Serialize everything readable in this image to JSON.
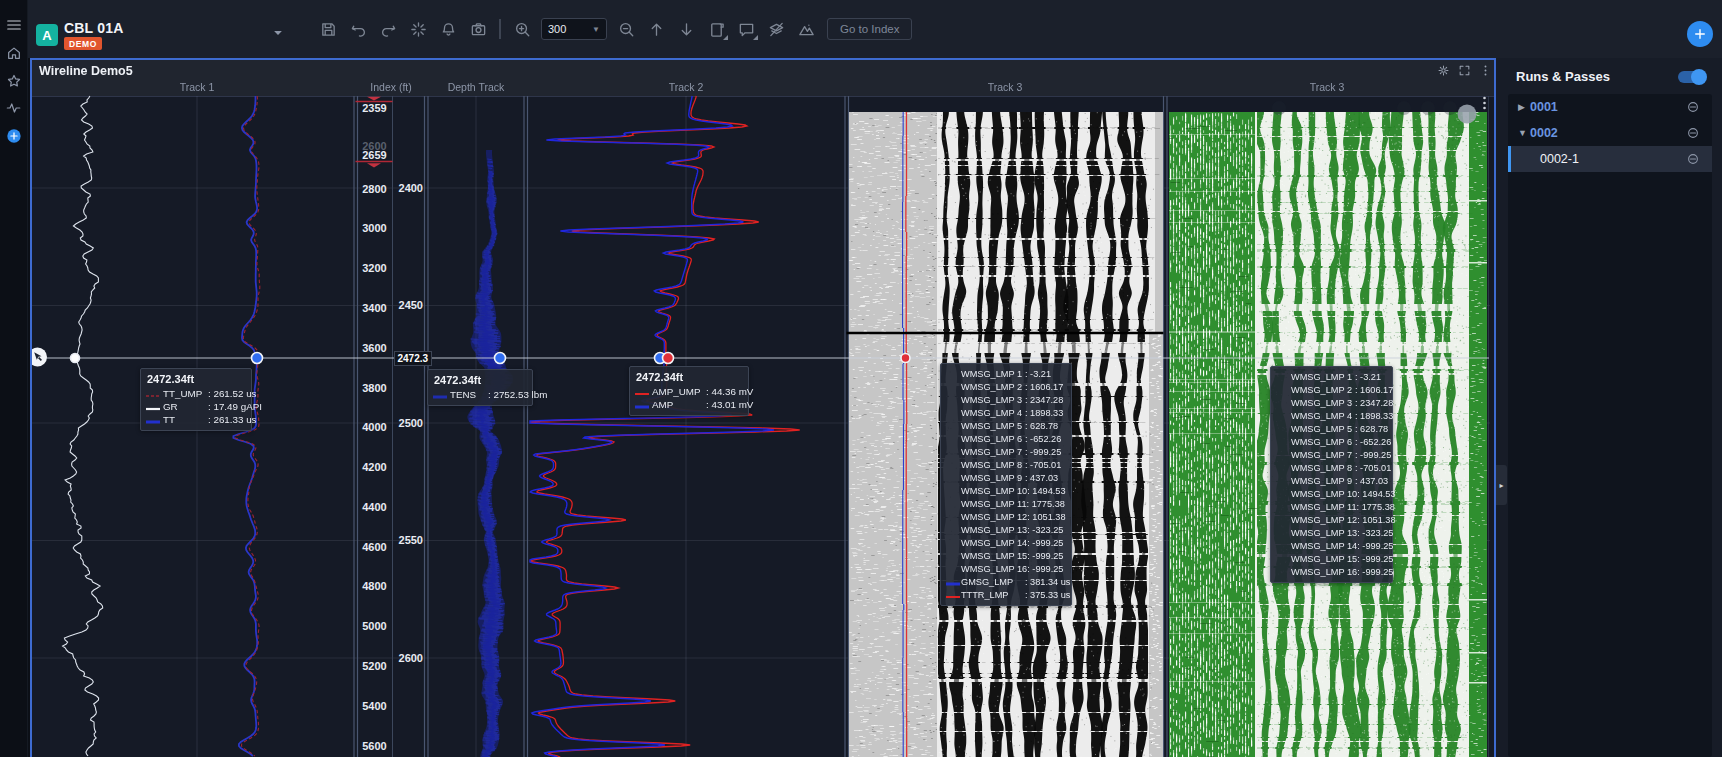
{
  "app": {
    "logo_glyph": "A",
    "title": "CBL 01A",
    "badge": "DEMO"
  },
  "sidebar": {
    "items": [
      {
        "icon": "menu-icon"
      },
      {
        "icon": "home-icon"
      },
      {
        "icon": "star-icon"
      },
      {
        "icon": "activity-icon"
      },
      {
        "icon": "plus-circle-icon"
      }
    ]
  },
  "toolbar": {
    "buttons_left": [
      "save",
      "undo",
      "redo",
      "auto-fit",
      "bell",
      "camera"
    ],
    "zoom_value": "300",
    "buttons_right": [
      "zoom-out",
      "arrow-up",
      "arrow-down",
      "report",
      "comment",
      "layers-off",
      "terrain"
    ],
    "buttons_with_submenu": [
      "report",
      "comment"
    ],
    "goto_label": "Go to Index",
    "add_label": "+"
  },
  "plot": {
    "title": "Wireline Demo5",
    "tracks": [
      {
        "label": "Track 1",
        "center": 197
      },
      {
        "label": "Index (ft)",
        "center": 391
      },
      {
        "label": "Depth Track",
        "center": 476
      },
      {
        "label": "Track 2",
        "center": 686
      },
      {
        "label": "Track 3",
        "center": 1005
      },
      {
        "label": "Track 3",
        "center": 1327
      }
    ],
    "curves": {
      "GR": {
        "color": "#dde3ec",
        "track": "Track 1"
      },
      "TT": {
        "color": "#2a36c8",
        "track": "Track 1"
      },
      "TT_UMP": {
        "color": "#9b2433",
        "track": "Track 1"
      },
      "TENS": {
        "color": "#2633cc",
        "track": "Depth Track"
      },
      "AMP": {
        "color": "#2026dd",
        "track": "Track 2"
      },
      "AMP_UMP": {
        "color": "#e02222",
        "track": "Track 2"
      },
      "VDL": {
        "color": "#0a0a0a",
        "track": "Track 3"
      },
      "VDL2": {
        "color": "#2b8a2b",
        "track": "Track 3"
      }
    }
  },
  "index_scale": {
    "overview_marker_top": "2359",
    "overview_faded_label": "2600",
    "overview_marker_bottom": "2659",
    "overview_ticks": [
      "2800",
      "3000",
      "3200",
      "3400",
      "3600",
      "3800",
      "4000",
      "4200",
      "4400",
      "4600",
      "4800",
      "5000",
      "5200",
      "5400",
      "5600"
    ],
    "inview_ticks": [
      "2400",
      "2450",
      "2500",
      "2550",
      "2600"
    ],
    "cursor_depth": "2472.3"
  },
  "tooltips": {
    "depth_header": "2472.34ft",
    "track1": {
      "rows": [
        {
          "name": "TT_UMP",
          "value": ": 261.52 us",
          "swatch": "red-dashed"
        },
        {
          "name": "GR",
          "value": ": 17.49 gAPI",
          "swatch": "white-solid"
        },
        {
          "name": "TT",
          "value": ": 261.33 us",
          "swatch": "blue-solid"
        }
      ]
    },
    "depth_track": {
      "rows": [
        {
          "name": "TENS",
          "value": ": 2752.53 lbm",
          "swatch": "navy-solid"
        }
      ]
    },
    "track2": {
      "rows": [
        {
          "name": "AMP_UMP",
          "value": ": 44.36 mV",
          "swatch": "red-solid"
        },
        {
          "name": "AMP",
          "value": ": 43.01 mV",
          "swatch": "blue-solid"
        }
      ]
    },
    "wmsg_labels": [
      "WMSG_LMP 1",
      "WMSG_LMP 2",
      "WMSG_LMP 3",
      "WMSG_LMP 4",
      "WMSG_LMP 5",
      "WMSG_LMP 6",
      "WMSG_LMP 7",
      "WMSG_LMP 8",
      "WMSG_LMP 9",
      "WMSG_LMP 10",
      "WMSG_LMP 11",
      "WMSG_LMP 12",
      "WMSG_LMP 13",
      "WMSG_LMP 14",
      "WMSG_LMP 15",
      "WMSG_LMP 16"
    ],
    "wmsg_values": [
      ": -3.21",
      ": 1606.17",
      ": 2347.28",
      ": 1898.33",
      ": 628.78",
      ": -652.26",
      ": -999.25",
      ": -705.01",
      ": 437.03",
      ": 1494.53",
      ": 1775.38",
      ": 1051.38",
      ": -323.25",
      ": -999.25",
      ": -999.25",
      ": -999.25"
    ],
    "wmsg_extra": [
      {
        "name": "GMSG_LMP",
        "value": ": 381.34 us",
        "swatch": "blue-solid"
      },
      {
        "name": "TTTR_LMP",
        "value": ": 375.33 us",
        "swatch": "red-solid"
      }
    ]
  },
  "right_panel": {
    "title": "Runs & Passes",
    "toggle_on": true,
    "items": [
      {
        "label": "0001",
        "caret": "right",
        "child": false,
        "selected": false
      },
      {
        "label": "0002",
        "caret": "down",
        "child": false,
        "selected": false
      },
      {
        "label": "0002-1",
        "caret": "none",
        "child": true,
        "selected": true
      }
    ]
  },
  "colors": {
    "accent_blue": "#2e8cf0",
    "badge_orange": "#e1552e",
    "logo_teal": "#14b2a0",
    "plot_border": "#3e6bd0",
    "marker_red": "#b02836",
    "crosshair": "#c9cfdb",
    "vdl_green": "#2b8a2b"
  }
}
